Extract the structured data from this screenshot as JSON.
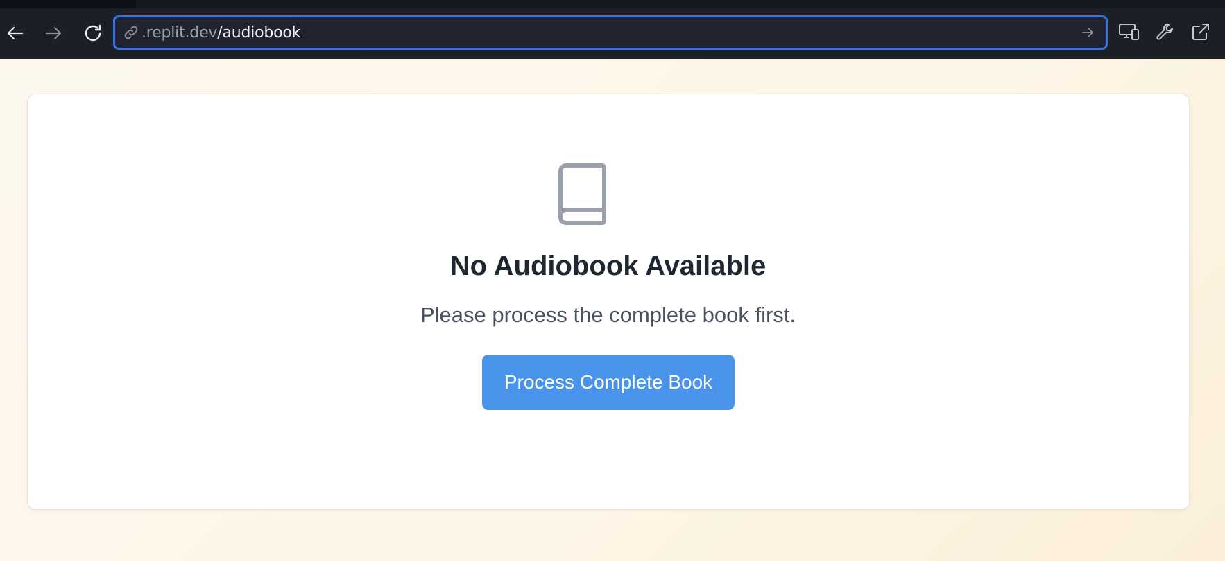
{
  "browser": {
    "url_host": ".replit.dev",
    "url_path": "/audiobook",
    "icons": {
      "back": "arrow-left-icon",
      "forward": "arrow-right-icon",
      "reload": "reload-icon",
      "link": "link-icon",
      "go": "arrow-right-icon",
      "devices": "devices-icon",
      "devtools": "wrench-icon",
      "open_external": "external-link-icon"
    }
  },
  "page": {
    "empty_state": {
      "icon": "book-icon",
      "title": "No Audiobook Available",
      "subtitle": "Please process the complete book first.",
      "button_label": "Process Complete Book"
    }
  },
  "colors": {
    "accent": "#4a93ea",
    "url_focus_border": "#3b74e0",
    "toolbar_bg": "#1b1f27",
    "page_bg": "#fdf6e9",
    "title": "#1f2733",
    "subtitle": "#4a5262",
    "icon_gray": "#9aa0ab"
  }
}
